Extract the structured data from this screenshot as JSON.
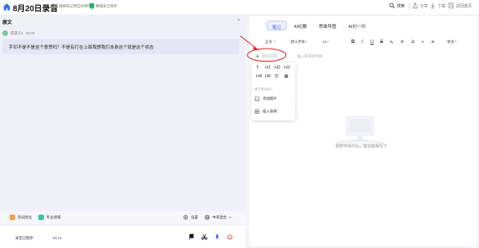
{
  "header": {
    "title": "8月20日录音",
    "save_status": "编辑笔记将自动保存",
    "protect_text": "数据安全保护",
    "search_label": "搜索",
    "share_label": "分享",
    "download_label": "下载",
    "about_label": "返回首页"
  },
  "left": {
    "section_title": "原文",
    "speaker": "说话人1",
    "timestamp": "00:09",
    "transcript": "手印不是不是这个意思吗？不是有打在上面我想我们本身这个就是这个状态",
    "tools": {
      "optimize": "热词优化",
      "domain": "专业领域",
      "settings": "设置",
      "language": "中英混合"
    },
    "status": "录音已暂停",
    "timer": "00:12"
  },
  "right": {
    "tabs": [
      "笔记",
      "AI纪要",
      "思维导图",
      "AI问一问"
    ],
    "active_tab": 0,
    "format": {
      "body": "正文",
      "font": "默认字体",
      "size": "14",
      "more": "更多"
    },
    "hint": "插入或添加内容",
    "empty_text": "我想不出什么，笔记来我写下",
    "dots": "···"
  },
  "popup": {
    "add_label": "添加内容",
    "headings": [
      "T",
      "H1",
      "H2",
      "H3",
      "H4",
      "H5"
    ],
    "section": "基于原文插入",
    "add_image": "添加图片",
    "insert_table": "插入表格"
  },
  "colors": {
    "accent": "#3a5af5",
    "record_red": "#e03030",
    "annotation_red": "#e02020"
  }
}
